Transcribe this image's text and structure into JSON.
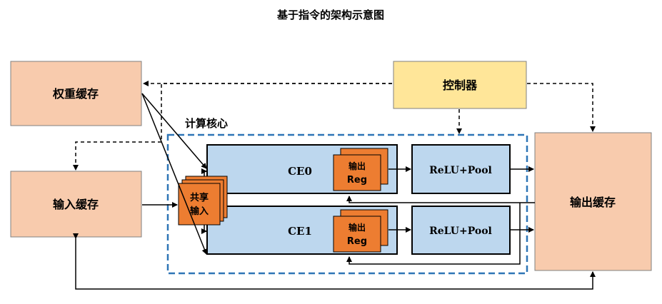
{
  "title": "基于指令的架构示意图",
  "blocks": {
    "weight_buffer": "权重缓存",
    "input_buffer": "输入缓存",
    "output_buffer": "输出缓存",
    "controller": "控制器",
    "compute_core": "计算核心",
    "shared_input_line1": "共享",
    "shared_input_line2": "输入",
    "ce0": "CE0",
    "ce1": "CE1",
    "reg_line1": "输出",
    "reg_line2": "Reg",
    "relu_pool": "ReLU+Pool"
  },
  "colors": {
    "buffer_fill": "#f8cbad",
    "controller_fill": "#ffe699",
    "ce_fill": "#bdd7ee",
    "orange_fill": "#ed7d31",
    "core_border": "#2e75b6"
  }
}
